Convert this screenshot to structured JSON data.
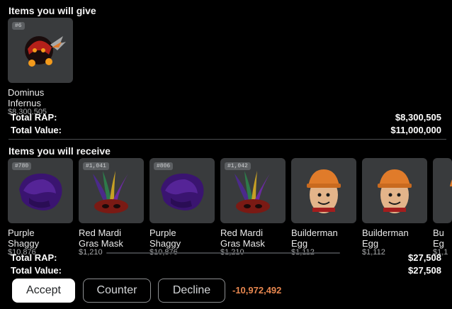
{
  "give": {
    "title": "Items you will give",
    "items": [
      {
        "serial": "#6",
        "name": "Dominus\nInfernus",
        "price": "$8,300,505",
        "icon": "dominus-infernus-icon"
      }
    ],
    "total_rap_label": "Total RAP:",
    "total_rap": "$8,300,505",
    "total_value_label": "Total Value:",
    "total_value": "$11,000,000"
  },
  "receive": {
    "title": "Items you will receive",
    "items": [
      {
        "serial": "#780",
        "name": "Purple\nShaggy",
        "price": "$10,876",
        "icon": "purple-shaggy-icon"
      },
      {
        "serial": "#1,041",
        "name": "Red Mardi\nGras Mask",
        "price": "$1,210",
        "icon": "mardi-gras-mask-icon"
      },
      {
        "serial": "#806",
        "name": "Purple\nShaggy",
        "price": "$10,876",
        "icon": "purple-shaggy-icon"
      },
      {
        "serial": "#1,042",
        "name": "Red Mardi\nGras Mask",
        "price": "$1,210",
        "icon": "mardi-gras-mask-icon"
      },
      {
        "serial": "",
        "name": "Builderman\nEgg",
        "price": "$1,112",
        "icon": "builderman-egg-icon"
      },
      {
        "serial": "",
        "name": "Builderman\nEgg",
        "price": "$1,112",
        "icon": "builderman-egg-icon"
      },
      {
        "serial": "",
        "name": "Bu\nEg",
        "price": "$1,1",
        "icon": "builderman-egg-icon"
      }
    ],
    "total_rap_label": "Total RAP:",
    "total_rap": "$27,508",
    "total_value_label": "Total Value:",
    "total_value": "$27,508"
  },
  "actions": {
    "accept": "Accept",
    "counter": "Counter",
    "decline": "Decline",
    "difference": "-10,972,492"
  },
  "colors": {
    "background": "#000000",
    "card": "#393b3d",
    "difference": "#e8874f",
    "accept_bg": "#ffffff"
  }
}
